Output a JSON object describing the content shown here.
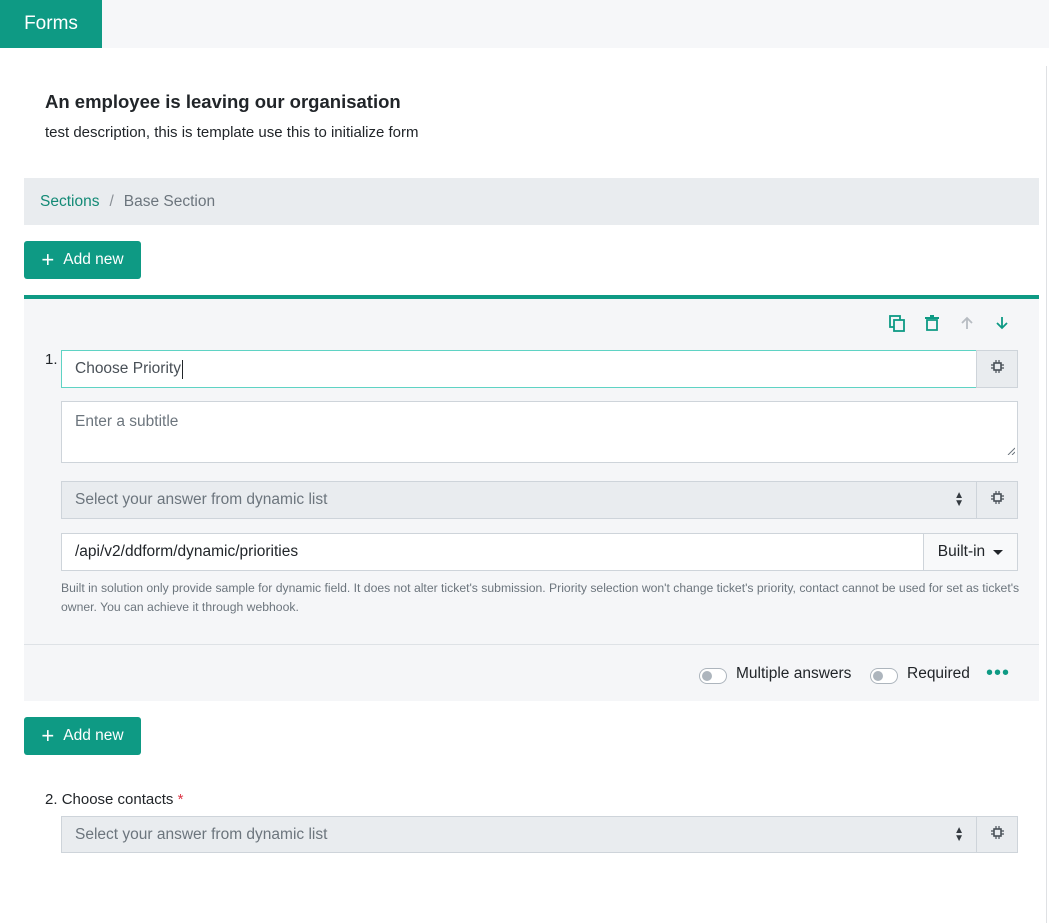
{
  "app": {
    "tab_label": "Forms"
  },
  "form": {
    "title": "An employee is leaving our organisation",
    "description": "test description, this is template use this to initialize form"
  },
  "breadcrumb": {
    "root": "Sections",
    "separator": "/",
    "current": "Base Section"
  },
  "add_button": {
    "label": "Add new",
    "icon": "plus-icon"
  },
  "question1": {
    "number": "1.",
    "title_value": "Choose Priority",
    "subtitle_placeholder": "Enter a subtitle",
    "answer_type_selected": "Select your answer from dynamic list",
    "api_url": "/api/v2/ddform/dynamic/priorities",
    "source_selected": "Built-in",
    "help_text": "Built in solution only provide sample for dynamic field. It does not alter ticket's submission. Priority selection won't change ticket's priority, contact cannot be used for set as ticket's owner. You can achieve it through webhook.",
    "toolbar_icons": [
      "copy-icon",
      "trash-icon",
      "arrow-up-icon",
      "arrow-down-icon"
    ],
    "multiple_answers_label": "Multiple answers",
    "multiple_answers_on": false,
    "required_label": "Required",
    "required_on": false
  },
  "question2": {
    "number": "2.",
    "title": "Choose contacts",
    "required_mark": "*",
    "answer_placeholder": "Select your answer from dynamic list"
  },
  "colors": {
    "accent": "#0e9a84",
    "link": "#138a76",
    "required": "#dc3545"
  }
}
